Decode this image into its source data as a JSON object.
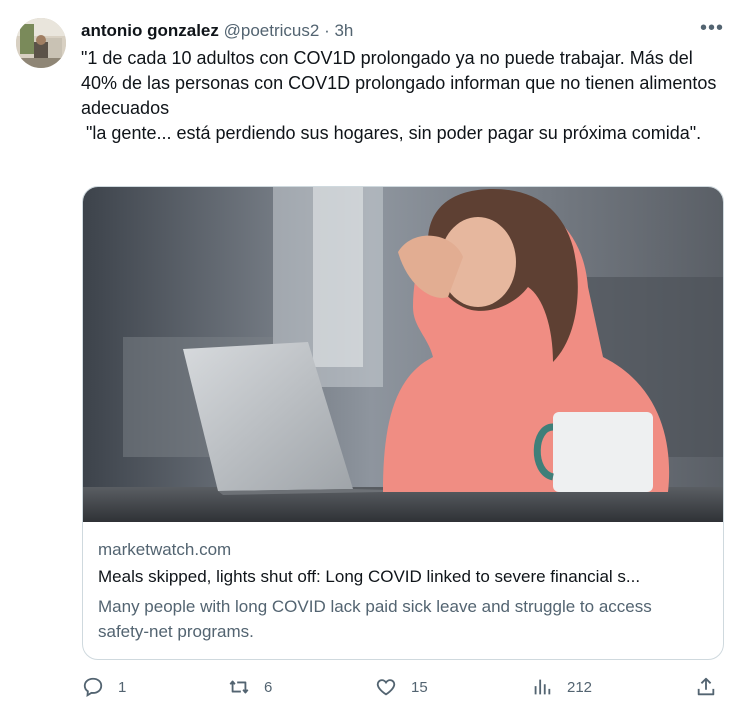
{
  "tweet": {
    "author_name": "antonio gonzalez",
    "handle": "@poetricus2",
    "separator": "·",
    "time": "3h",
    "more": "•••",
    "text": "\"1 de cada 10 adultos con COV1D prolongado ya no puede trabajar. Más del 40% de las personas con COV1D prolongado informan que no tienen alimentos adecuados\n \"la gente... está perdiendo sus hogares, sin poder pagar su próxima comida\"."
  },
  "card": {
    "domain": "marketwatch.com",
    "title": "Meals skipped, lights shut off: Long COVID linked to severe financial s...",
    "description": "Many people with long COVID lack paid sick leave and struggle to access safety-net programs."
  },
  "actions": {
    "reply_count": "1",
    "retweet_count": "6",
    "like_count": "15",
    "views_count": "212"
  },
  "icons": {
    "reply": "reply-icon",
    "retweet": "retweet-icon",
    "like": "heart-icon",
    "views": "views-icon",
    "share": "share-icon"
  },
  "colors": {
    "text_primary": "#0f1419",
    "text_secondary": "#536471",
    "border": "#cfd9de"
  }
}
